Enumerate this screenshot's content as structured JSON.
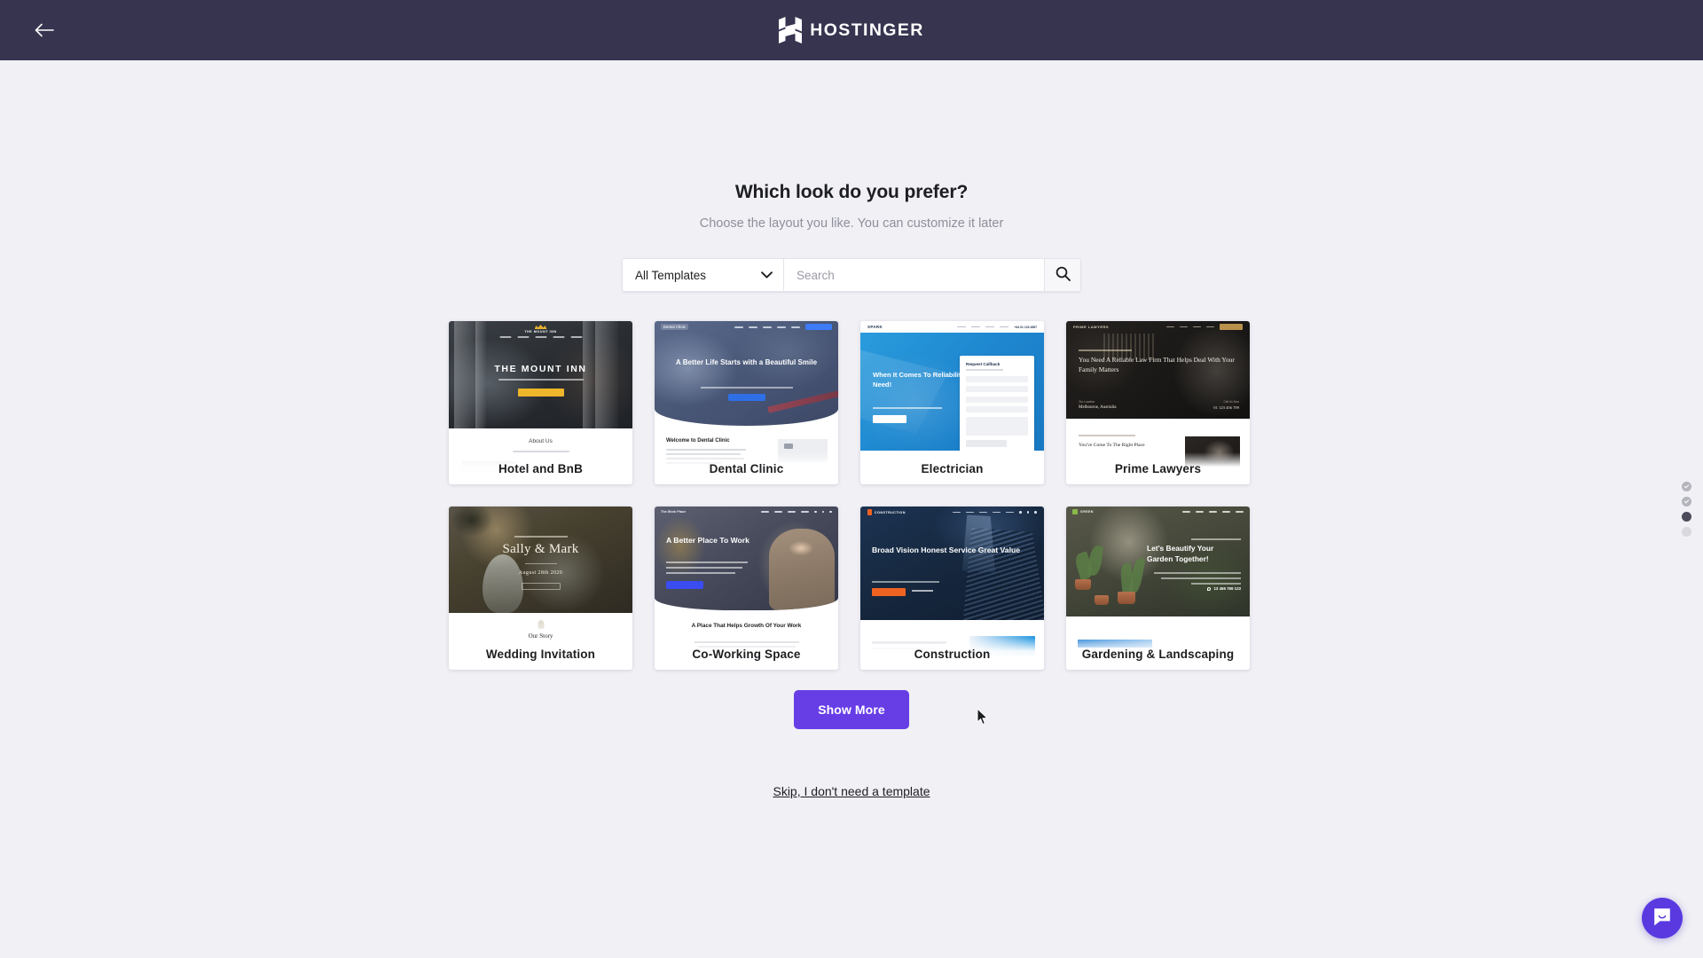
{
  "header": {
    "back_label": "Back",
    "brand": "HOSTINGER"
  },
  "main": {
    "title": "Which look do you prefer?",
    "subtitle": "Choose the layout you like. You can customize it later"
  },
  "search": {
    "filter_selected": "All Templates",
    "filter_options": [
      "All Templates"
    ],
    "placeholder": "Search",
    "value": "",
    "search_icon": "magnifier-icon",
    "chevron_icon": "chevron-down-icon"
  },
  "templates": [
    {
      "name": "Hotel and BnB",
      "hero_title": "THE MOUNT INN",
      "logo": "THE MOUNT INN",
      "section_title": "About Us"
    },
    {
      "name": "Dental Clinic",
      "hero_title": "A Better Life Starts with a Beautiful Smile",
      "logo": "Dental Clinic",
      "section_title": "Welcome to Dental Clinic"
    },
    {
      "name": "Electrician",
      "hero_title": "When It Comes To Reliability, We Are The One You Need!",
      "logo": "SPARK",
      "form_title": "Request Callback"
    },
    {
      "name": "Prime Lawyers",
      "hero_title": "You Need A Reliable Law Firm That Helps Deal With Your Family Matters",
      "logo": "PRIME LAWYERS",
      "location_label": "Our Location",
      "location": "Melbourne, Australia",
      "phone_label": "Call Us Now",
      "phone": "01 123 456 789",
      "section_title": "You've Come To The Right Place"
    },
    {
      "name": "Wedding Invitation",
      "hero_title": "Sally & Mark",
      "hero_date": "August 28th 2020",
      "section_title": "Our Story"
    },
    {
      "name": "Co-Working Space",
      "hero_title": "A Better Place To Work",
      "logo": "The Work Place",
      "section_title": "A Place That Helps Growth Of Your Work"
    },
    {
      "name": "Construction",
      "hero_title": "Broad Vision Honest Service Great Value",
      "logo": "CONSTRUCTION"
    },
    {
      "name": "Gardening & Landscaping",
      "hero_title": "Let's Beautify Your Garden Together!",
      "logo": "GREEN",
      "phone": "13 456 789 123"
    }
  ],
  "actions": {
    "show_more": "Show More",
    "skip": "Skip, I don't need a template"
  },
  "stepper": {
    "steps": [
      {
        "state": "done"
      },
      {
        "state": "done"
      },
      {
        "state": "current"
      },
      {
        "state": "upcoming"
      }
    ]
  },
  "chat": {
    "icon": "chat-bubble-icon"
  },
  "colors": {
    "header_bg": "#36344f",
    "page_bg": "#f0f0f5",
    "accent": "#673de6",
    "chat_bg": "#5a3ae0"
  }
}
